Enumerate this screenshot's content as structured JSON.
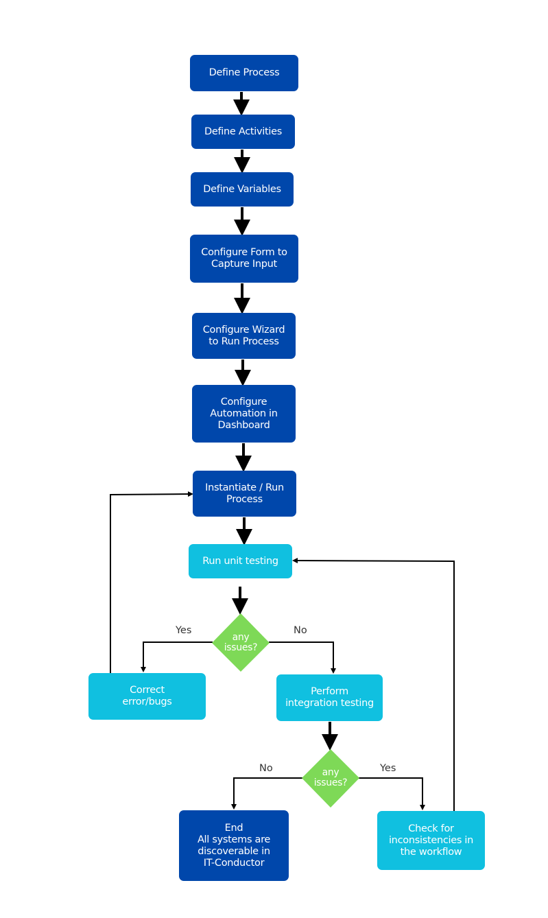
{
  "colors": {
    "primary_box": "#0047AB",
    "secondary_box": "#10C0E0",
    "decision": "#7ED957",
    "connector": "#000000",
    "box_text": "#FFFFFF"
  },
  "nodes": {
    "define_process": "Define Process",
    "define_activities": "Define Activities",
    "define_variables": "Define Variables",
    "configure_form": "Configure Form to\nCapture Input",
    "configure_wizard": "Configure Wizard\nto Run Process",
    "configure_automation": "Configure\nAutomation in\nDashboard",
    "instantiate_run": "Instantiate / Run\nProcess",
    "run_unit_testing": "Run unit testing",
    "correct_errors": "Correct\nerror/bugs",
    "perform_integration": "Perform\nintegration testing",
    "end": "End\nAll systems are\ndiscoverable in\nIT-Conductor",
    "check_inconsistencies": "Check for\ninconsistencies in\nthe workflow"
  },
  "decisions": {
    "decision_1": "any\nissues?",
    "decision_2": "any\nissues?"
  },
  "edge_labels": {
    "d1_yes": "Yes",
    "d1_no": "No",
    "d2_no": "No",
    "d2_yes": "Yes"
  }
}
